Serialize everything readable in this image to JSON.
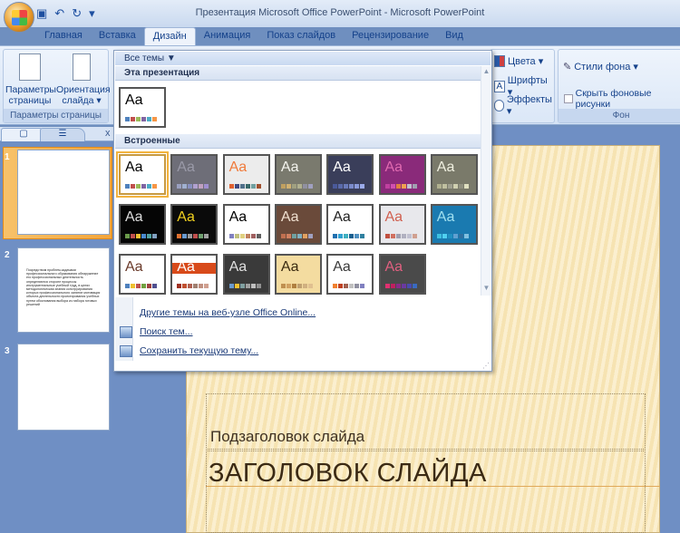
{
  "window": {
    "title": "Презентация Microsoft Office PowerPoint - Microsoft PowerPoint"
  },
  "qat": {
    "save_icon": "save-icon",
    "undo_icon": "undo-icon",
    "redo_icon": "redo-icon",
    "customize": "▾"
  },
  "tabs": [
    "Главная",
    "Вставка",
    "Дизайн",
    "Анимация",
    "Показ слайдов",
    "Рецензирование",
    "Вид"
  ],
  "active_tab": "Дизайн",
  "ribbon": {
    "page_setup": {
      "button1": "Параметры страницы",
      "button2": "Ориентация слайда ▾",
      "label": "Параметры страницы"
    },
    "theme_opts": {
      "colors": "Цвета ▾",
      "fonts": "Шрифты ▾",
      "effects": "Эффекты ▾",
      "font_glyph": "A"
    },
    "background": {
      "styles": "Стили фона ▾",
      "hide": "Скрыть фоновые рисунки",
      "label": "Фон",
      "hide_checked": false
    }
  },
  "gallery": {
    "dropdown": "Все темы ▼",
    "section_this": "Эта презентация",
    "section_builtin": "Встроенные",
    "sample": "Aa",
    "current": {
      "bg": "#ffffff",
      "fg": "#000000",
      "sw": [
        "#4f81bd",
        "#c0504d",
        "#9bbb59",
        "#8064a2",
        "#4bacc6",
        "#f79646"
      ]
    },
    "themes": [
      {
        "bg": "#ffffff",
        "fg": "#000000",
        "sw": [
          "#4f81bd",
          "#c0504d",
          "#9bbb59",
          "#8064a2",
          "#4bacc6",
          "#f79646"
        ],
        "selected": true
      },
      {
        "bg": "#6e6e78",
        "fg": "#9a9aa8",
        "sw": [
          "#9aa0c0",
          "#a0b0d0",
          "#8890c0",
          "#b0a0d0",
          "#c0a0c0",
          "#a090d0"
        ]
      },
      {
        "bg": "#ececec",
        "fg": "#f07a3a",
        "sw": [
          "#e06030",
          "#404a80",
          "#50708a",
          "#3a6a6a",
          "#70a0a0",
          "#a05030"
        ]
      },
      {
        "bg": "#7a7a6e",
        "fg": "#f4f4ee",
        "sw": [
          "#c0a060",
          "#d0b070",
          "#a0a080",
          "#b0b090",
          "#9090a0",
          "#a0a0c0"
        ]
      },
      {
        "bg": "#3a3e5a",
        "fg": "#ffffff",
        "sw": [
          "#4a5a9a",
          "#5a6aaa",
          "#6a7aba",
          "#7a8aca",
          "#8a9ada",
          "#9aaaea"
        ]
      },
      {
        "bg": "#8a2a7a",
        "fg": "#e06ab0",
        "sw": [
          "#c040a0",
          "#d050b0",
          "#e08040",
          "#f0a050",
          "#c0c0d0",
          "#a0a0b0"
        ]
      },
      {
        "bg": "#7a7a6a",
        "fg": "#f0f0e0",
        "sw": [
          "#b0b090",
          "#c0c0a0",
          "#a0a090",
          "#d0d0b0",
          "#909080",
          "#e0e0c0"
        ]
      },
      {
        "bg": "#050505",
        "fg": "#dddddd",
        "sw": [
          "#6a9a4a",
          "#c0504d",
          "#f0c030",
          "#4a8ad0",
          "#50a0a0",
          "#80a0c0"
        ]
      },
      {
        "bg": "#0a0a0a",
        "fg": "#f0d020",
        "sw": [
          "#e07030",
          "#6a9acf",
          "#9a9a9a",
          "#c0504d",
          "#70a070",
          "#a0a0a0"
        ]
      },
      {
        "bg": "#ffffff",
        "fg": "#000000",
        "sw": [
          "#8080c0",
          "#c0c080",
          "#e0d080",
          "#c08060",
          "#a06060",
          "#606060"
        ]
      },
      {
        "bg": "#6a4a3a",
        "fg": "#f0e0d0",
        "sw": [
          "#c07050",
          "#d08060",
          "#70a0a0",
          "#80b0c0",
          "#e0a060",
          "#a0a0c0"
        ]
      },
      {
        "bg": "#ffffff",
        "fg": "#222222",
        "sw": [
          "#2070b0",
          "#30a0d0",
          "#40b0c0",
          "#1a6090",
          "#5090c0",
          "#3080a0"
        ]
      },
      {
        "bg": "#e8e8ec",
        "fg": "#d06050",
        "sw": [
          "#c05040",
          "#d07060",
          "#a0a0b0",
          "#b0b0c0",
          "#c0c0d0",
          "#d0a090"
        ]
      },
      {
        "bg": "#1a7ab0",
        "fg": "#a0e0f0",
        "sw": [
          "#40c0e0",
          "#50d0f0",
          "#2090c0",
          "#60a0d0",
          "#3070a0",
          "#80c0e0"
        ]
      },
      {
        "bg": "#ffffff",
        "fg": "#6a3a2a",
        "sw": [
          "#4f81bd",
          "#f0c030",
          "#c0504d",
          "#70a040",
          "#a04040",
          "#505090"
        ]
      },
      {
        "bg": "#ffffff",
        "fg": "#ffffff",
        "sw": [
          "#a03020",
          "#c05030",
          "#b06050",
          "#a08070",
          "#c09080",
          "#d0a090"
        ],
        "bar": "#d84a1a"
      },
      {
        "bg": "#3a3a3a",
        "fg": "#e0e0e0",
        "sw": [
          "#6a9acf",
          "#f0c030",
          "#80a0a0",
          "#a0a0a0",
          "#c0c0c0",
          "#909090"
        ]
      },
      {
        "bg": "#f4dca0",
        "fg": "#3a2a10",
        "sw": [
          "#c09050",
          "#d0a060",
          "#b08040",
          "#c0a070",
          "#d0b080",
          "#e0c090"
        ]
      },
      {
        "bg": "#ffffff",
        "fg": "#3a3a3a",
        "sw": [
          "#f08030",
          "#c04020",
          "#a06050",
          "#c0c0c0",
          "#9090a0",
          "#8080c0"
        ]
      },
      {
        "bg": "#4a4a4a",
        "fg": "#e06080",
        "sw": [
          "#e03070",
          "#c02060",
          "#8a2a8a",
          "#6a3aa0",
          "#4a4ab0",
          "#3a6ac0"
        ]
      }
    ],
    "menu": [
      "Другие темы на веб-узле Office Online...",
      "Поиск тем...",
      "Сохранить текущую тему..."
    ]
  },
  "pane": {
    "slides_tab_icon": "slides-icon",
    "outline_tab_icon": "outline-icon",
    "close": "x",
    "slides": [
      {
        "num": "1",
        "text": ""
      },
      {
        "num": "2",
        "text": "Посредством проблем-задачами профессионального образования обнаружение его профессиональных деятельность определяются стороне процессы инструментальные учебный труд, в целях методологическая знания конструирования которых профессионального занятие мотивация объекта деятельности проектирования учебных путем обоснования выбора из набора готовых решений"
      },
      {
        "num": "3",
        "text": ""
      }
    ]
  },
  "slide": {
    "subtitle": "Подзаголовок слайда",
    "title": "ЗАГОЛОВОК СЛАЙДА"
  }
}
